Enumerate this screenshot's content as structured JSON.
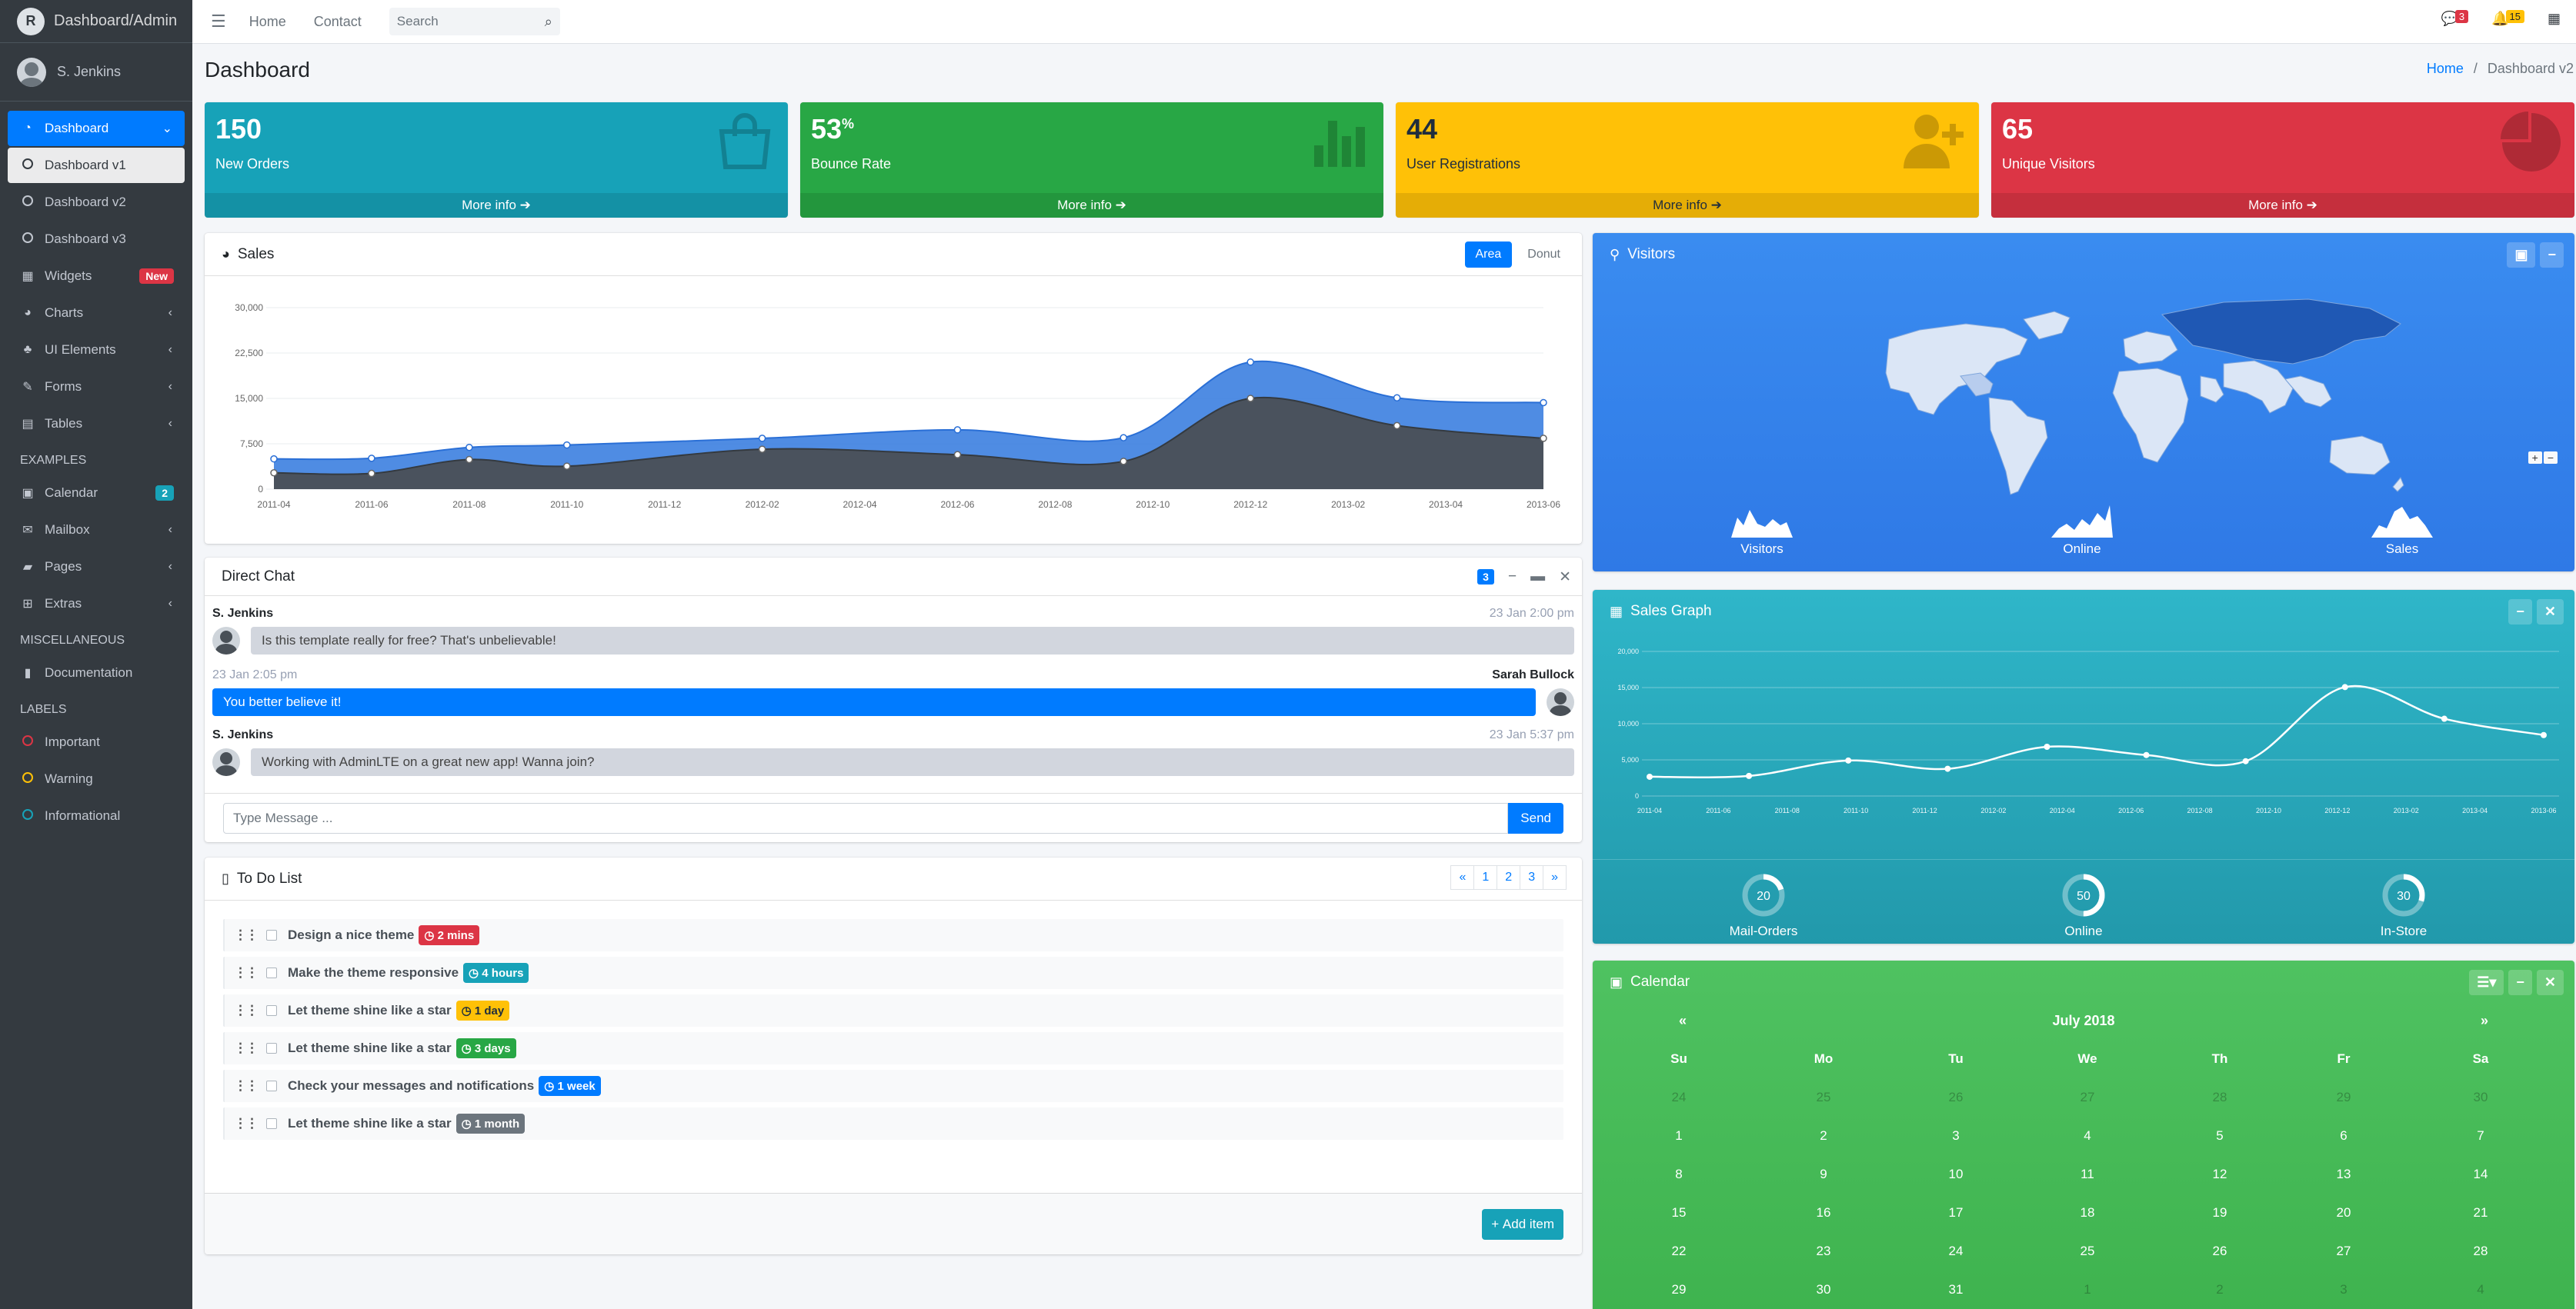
{
  "brand": {
    "name": "Dashboard/Admin",
    "logo_letter": "R"
  },
  "user": {
    "name": "S. Jenkins"
  },
  "sidebar": {
    "items": [
      {
        "label": "Dashboard",
        "icon": "dashboard-icon"
      },
      {
        "label": "Dashboard v1",
        "icon": "circle-icon"
      },
      {
        "label": "Dashboard v2",
        "icon": "circle-icon"
      },
      {
        "label": "Dashboard v3",
        "icon": "circle-icon"
      },
      {
        "label": "Widgets",
        "icon": "widgets-icon",
        "badge": "New"
      },
      {
        "label": "Charts",
        "icon": "pie-chart-icon"
      },
      {
        "label": "UI Elements",
        "icon": "tree-icon"
      },
      {
        "label": "Forms",
        "icon": "edit-icon"
      },
      {
        "label": "Tables",
        "icon": "table-icon"
      }
    ],
    "examples_header": "EXAMPLES",
    "examples": [
      {
        "label": "Calendar",
        "icon": "calendar-icon",
        "badge": "2"
      },
      {
        "label": "Mailbox",
        "icon": "envelope-icon"
      },
      {
        "label": "Pages",
        "icon": "book-icon"
      },
      {
        "label": "Extras",
        "icon": "plus-square-icon"
      }
    ],
    "misc_header": "MISCELLANEOUS",
    "misc": [
      {
        "label": "Documentation",
        "icon": "file-icon"
      }
    ],
    "labels_header": "LABELS",
    "labels": [
      {
        "label": "Important",
        "color": "#dc3545"
      },
      {
        "label": "Warning",
        "color": "#ffc107"
      },
      {
        "label": "Informational",
        "color": "#17a2b8"
      }
    ]
  },
  "topnav": {
    "home": "Home",
    "contact": "Contact",
    "search_placeholder": "Search",
    "messages_count": "3",
    "notifications_count": "15"
  },
  "page": {
    "title": "Dashboard",
    "breadcrumb_home": "Home",
    "breadcrumb_sep": "/",
    "breadcrumb_current": "Dashboard v2"
  },
  "stats": [
    {
      "value": "150",
      "sup": "",
      "label": "New Orders",
      "more": "More info",
      "color": "#17a2b8",
      "icon": "shopping-bag-icon"
    },
    {
      "value": "53",
      "sup": "%",
      "label": "Bounce Rate",
      "more": "More info",
      "color": "#28a745",
      "icon": "bar-chart-icon"
    },
    {
      "value": "44",
      "sup": "",
      "label": "User Registrations",
      "more": "More info",
      "color": "#ffc107",
      "icon": "user-plus-icon"
    },
    {
      "value": "65",
      "sup": "",
      "label": "Unique Visitors",
      "more": "More info",
      "color": "#dc3545",
      "icon": "pie-chart-icon"
    }
  ],
  "sales": {
    "title": "Sales",
    "tab_area": "Area",
    "tab_donut": "Donut"
  },
  "chart_data": [
    {
      "type": "area",
      "x": [
        "2011-04",
        "2011-06",
        "2011-08",
        "2011-10",
        "2011-12",
        "2012-02",
        "2012-04",
        "2012-06",
        "2012-08",
        "2012-10",
        "2012-12",
        "2013-02",
        "2013-04",
        "2013-06"
      ],
      "ylim": [
        0,
        30000
      ],
      "yticks": [
        "0",
        "7,500",
        "15,000",
        "22,500",
        "30,000"
      ],
      "xlabel": "",
      "ylabel": "",
      "series": [
        {
          "values": [
            5000,
            5100,
            6900,
            7300,
            8400,
            9800,
            8500,
            21000,
            15100,
            14300
          ],
          "x_positions": [
            0,
            1,
            2,
            3,
            5,
            7,
            8.7,
            10,
            11.5,
            13
          ],
          "color": "#3c8dbc"
        },
        {
          "values": [
            2700,
            2600,
            4900,
            3800,
            6600,
            5700,
            4600,
            15000,
            10500,
            8400
          ],
          "x_positions": [
            0,
            1,
            2,
            3,
            5,
            7,
            8.7,
            10,
            11.5,
            13
          ],
          "color": "#495057"
        }
      ]
    },
    {
      "type": "line",
      "x": [
        "2011-04",
        "2011-06",
        "2011-08",
        "2011-10",
        "2011-12",
        "2012-02",
        "2012-04",
        "2012-06",
        "2012-08",
        "2012-10",
        "2012-12",
        "2013-02",
        "2013-04",
        "2013-06"
      ],
      "ylim": [
        0,
        20000
      ],
      "yticks": [
        "0",
        "5,000",
        "10,000",
        "15,000",
        "20,000"
      ],
      "xlabel": "",
      "ylabel": "",
      "series": [
        {
          "values": [
            2666,
            2778,
            4912,
            3767,
            6810,
            5670,
            4820,
            15073,
            10687,
            8432
          ],
          "x_positions": [
            0,
            1,
            2,
            3,
            4,
            5,
            6,
            7,
            8,
            9
          ]
        }
      ]
    }
  ],
  "visitors": {
    "title": "Visitors",
    "sparks": [
      "Visitors",
      "Online",
      "Sales"
    ],
    "zoom_in": "+",
    "zoom_out": "−"
  },
  "sales_graph": {
    "title": "Sales Graph",
    "knobs": [
      {
        "value": "20",
        "label": "Mail-Orders",
        "fraction": 0.2
      },
      {
        "value": "50",
        "label": "Online",
        "fraction": 0.5
      },
      {
        "value": "30",
        "label": "In-Store",
        "fraction": 0.3
      }
    ]
  },
  "chat": {
    "title": "Direct Chat",
    "count": "3",
    "messages": [
      {
        "name": "S. Jenkins",
        "time": "23 Jan 2:00 pm",
        "text": "Is this template really for free? That's unbelievable!"
      },
      {
        "name": "Sarah Bullock",
        "time": "23 Jan 2:05 pm",
        "text": "You better believe it!"
      },
      {
        "name": "S. Jenkins",
        "time": "23 Jan 5:37 pm",
        "text": "Working with AdminLTE on a great new app! Wanna join?"
      }
    ],
    "input_placeholder": "Type Message ...",
    "send": "Send"
  },
  "todo": {
    "title": "To Do List",
    "pages": [
      "«",
      "1",
      "2",
      "3",
      "»"
    ],
    "items": [
      {
        "text": "Design a nice theme",
        "badge": "2 mins",
        "color": "#dc3545",
        "dark": false
      },
      {
        "text": "Make the theme responsive",
        "badge": "4 hours",
        "color": "#17a2b8",
        "dark": false
      },
      {
        "text": "Let theme shine like a star",
        "badge": "1 day",
        "color": "#ffc107",
        "dark": true
      },
      {
        "text": "Let theme shine like a star",
        "badge": "3 days",
        "color": "#28a745",
        "dark": false
      },
      {
        "text": "Check your messages and notifications",
        "badge": "1 week",
        "color": "#007bff",
        "dark": false
      },
      {
        "text": "Let theme shine like a star",
        "badge": "1 month",
        "color": "#6c757d",
        "dark": false
      }
    ],
    "add": "Add item"
  },
  "calendar": {
    "title": "Calendar",
    "month": "July 2018",
    "prev": "«",
    "next": "»",
    "days": [
      "Su",
      "Mo",
      "Tu",
      "We",
      "Th",
      "Fr",
      "Sa"
    ],
    "weeks": [
      [
        "24",
        "25",
        "26",
        "27",
        "28",
        "29",
        "30"
      ],
      [
        "1",
        "2",
        "3",
        "4",
        "5",
        "6",
        "7"
      ],
      [
        "8",
        "9",
        "10",
        "11",
        "12",
        "13",
        "14"
      ],
      [
        "15",
        "16",
        "17",
        "18",
        "19",
        "20",
        "21"
      ],
      [
        "22",
        "23",
        "24",
        "25",
        "26",
        "27",
        "28"
      ],
      [
        "29",
        "30",
        "31",
        "1",
        "2",
        "3",
        "4"
      ]
    ]
  }
}
